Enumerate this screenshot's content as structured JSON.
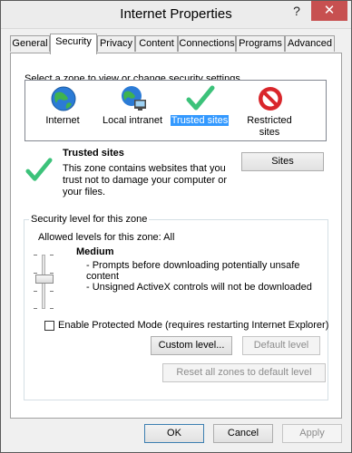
{
  "window": {
    "title": "Internet Properties",
    "help": "?",
    "close": "✕"
  },
  "tabs": [
    {
      "label": "General"
    },
    {
      "label": "Security"
    },
    {
      "label": "Privacy"
    },
    {
      "label": "Content"
    },
    {
      "label": "Connections"
    },
    {
      "label": "Programs"
    },
    {
      "label": "Advanced"
    }
  ],
  "active_tab": "Security",
  "security": {
    "instruction": "Select a zone to view or change security settings.",
    "zones": [
      {
        "line1": "Internet",
        "line2": "",
        "icon": "globe-icon"
      },
      {
        "line1": "Local intranet",
        "line2": "",
        "icon": "intranet-globe-icon"
      },
      {
        "line1": "Trusted sites",
        "line2": "",
        "icon": "checkmark-icon"
      },
      {
        "line1": "Restricted",
        "line2": "sites",
        "icon": "no-entry-icon"
      }
    ],
    "selected_zone": "Trusted sites",
    "zone_title": "Trusted sites",
    "zone_desc": [
      "This zone contains websites that you",
      "trust not to damage your computer or",
      "your files."
    ],
    "sites_button": "Sites",
    "level_group": "Security level for this zone",
    "allowed_levels": "Allowed levels for this zone: All",
    "level_name": "Medium",
    "level_desc": [
      "- Prompts before downloading potentially unsafe",
      "content",
      "- Unsigned ActiveX controls will not be downloaded"
    ],
    "protected_mode": "Enable Protected Mode (requires restarting Internet Explorer)",
    "protected_mode_checked": false,
    "custom_level_button": "Custom level...",
    "default_level_button": "Default level",
    "reset_all_button": "Reset all zones to default level"
  },
  "footer": {
    "ok": "OK",
    "cancel": "Cancel",
    "apply": "Apply"
  },
  "colors": {
    "selection": "#3399ff",
    "checkmark": "#3cc27a",
    "close": "#c75050",
    "restricted": "#d9262b"
  }
}
